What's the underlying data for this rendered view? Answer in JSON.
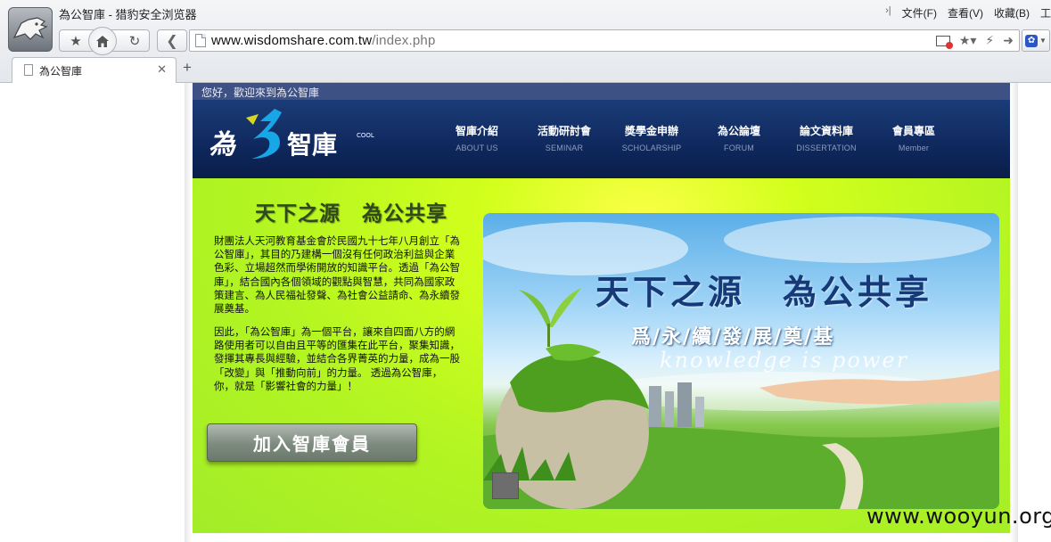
{
  "browser": {
    "window_title": "為公智庫 - 猎豹安全浏览器",
    "menu": [
      "文件(F)",
      "查看(V)",
      "收藏(B)",
      "工"
    ],
    "url_host": "www.wisdomshare.com.tw",
    "url_path": "/index.php",
    "tab_title": "為公智庫",
    "new_tab": "+"
  },
  "site": {
    "welcome": "您好，歡迎來到為公智庫",
    "nav": [
      {
        "zh": "智庫介紹",
        "en": "ABOUT US"
      },
      {
        "zh": "活動研討會",
        "en": "SEMINAR"
      },
      {
        "zh": "獎學金申辦",
        "en": "SCHOLARSHIP"
      },
      {
        "zh": "為公論壇",
        "en": "FORUM"
      },
      {
        "zh": "論文資料庫",
        "en": "DISSERTATION"
      },
      {
        "zh": "會員專區",
        "en": "Member"
      }
    ],
    "slogan": "天下之源　為公共享",
    "intro_1": "財團法人天河教育基金會於民國九十七年八月創立「為公智庫」，其目的乃建構一個沒有任何政治利益與企業色彩、立場超然而學術開放的知識平台。透過「為公智庫」，結合國內各個領域的觀點與智慧，共同為國家政策建言、為人民福祉發聲、為社會公益請命、為永續發展奠基。",
    "intro_2": "因此，「為公智庫」為一個平台，讓來自四面八方的網路使用者可以自由且平等的匯集在此平台，聚集知識，發揮其專長與經驗，並結合各界菁英的力量，成為一股「改變」與「推動向前」的力量。 透過為公智庫，你，就是「影響社會的力量」！",
    "join_button": "加入智庫會員",
    "banner": {
      "title": "天下之源　為公共享",
      "subtitle": "爲/永/續/發/展/奠/基",
      "tagline": "knowledge is power"
    }
  },
  "watermark": "www.wooyun.org",
  "colors": {
    "header_navy": "#0d2558",
    "welcome_bar": "#3e5184",
    "main_green": "#b3f522",
    "logo_cyan": "#19a6e6",
    "logo_yellow": "#d8d621"
  }
}
